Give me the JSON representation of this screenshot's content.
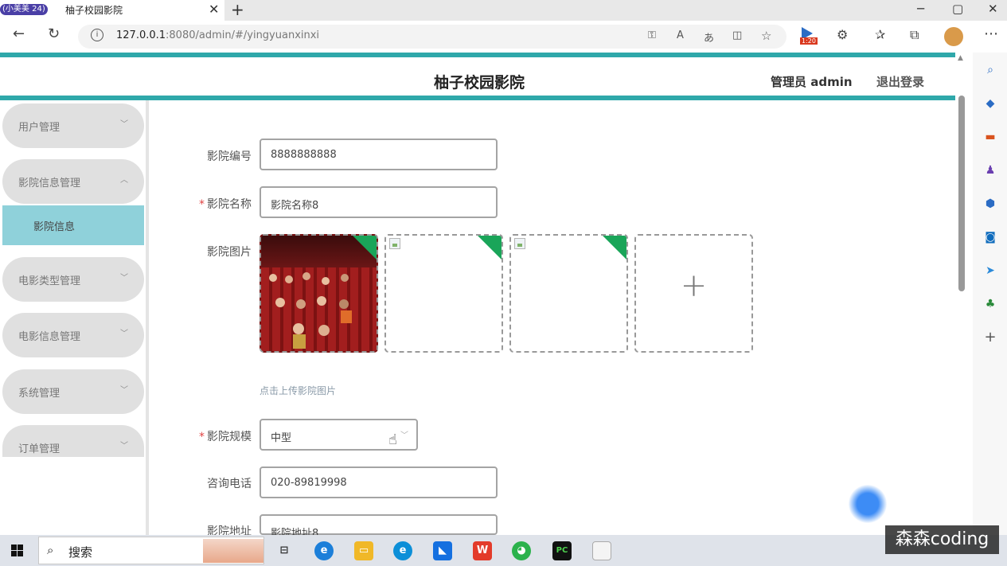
{
  "browser": {
    "tab_badge": "小美美 24",
    "tab_title": "柚子校园影院",
    "close_glyph": "✕",
    "new_tab_glyph": "+",
    "url_host": "127.0.0.1",
    "url_rest": ":8080/admin/#/yingyuanxinxi",
    "download_badge": "1:20"
  },
  "header": {
    "title": "柚子校园影院",
    "admin_label": "管理员 admin",
    "logout_label": "退出登录",
    "accent_color": "#2fa8aa"
  },
  "sidebar": {
    "items": [
      {
        "label": "用户管理"
      },
      {
        "label": "影院信息管理"
      },
      {
        "label": "电影类型管理"
      },
      {
        "label": "电影信息管理"
      },
      {
        "label": "系统管理"
      },
      {
        "label": "订单管理"
      }
    ],
    "sub_item": "影院信息",
    "sub_item_color": "#8fd1da"
  },
  "form": {
    "code_label": "影院编号",
    "code_value": "8888888888",
    "name_label": "影院名称",
    "name_value": "影院名称8",
    "image_label": "影院图片",
    "upload_hint": "点击上传影院图片",
    "add_glyph": "+",
    "scale_label": "影院规模",
    "scale_value": "中型",
    "phone_label": "咨询电话",
    "phone_value": "020-89819998",
    "address_label": "影院地址",
    "address_value": "影院地址8",
    "required_mark": "*"
  },
  "taskbar": {
    "search_label": "搜索"
  },
  "watermark": "森森coding"
}
